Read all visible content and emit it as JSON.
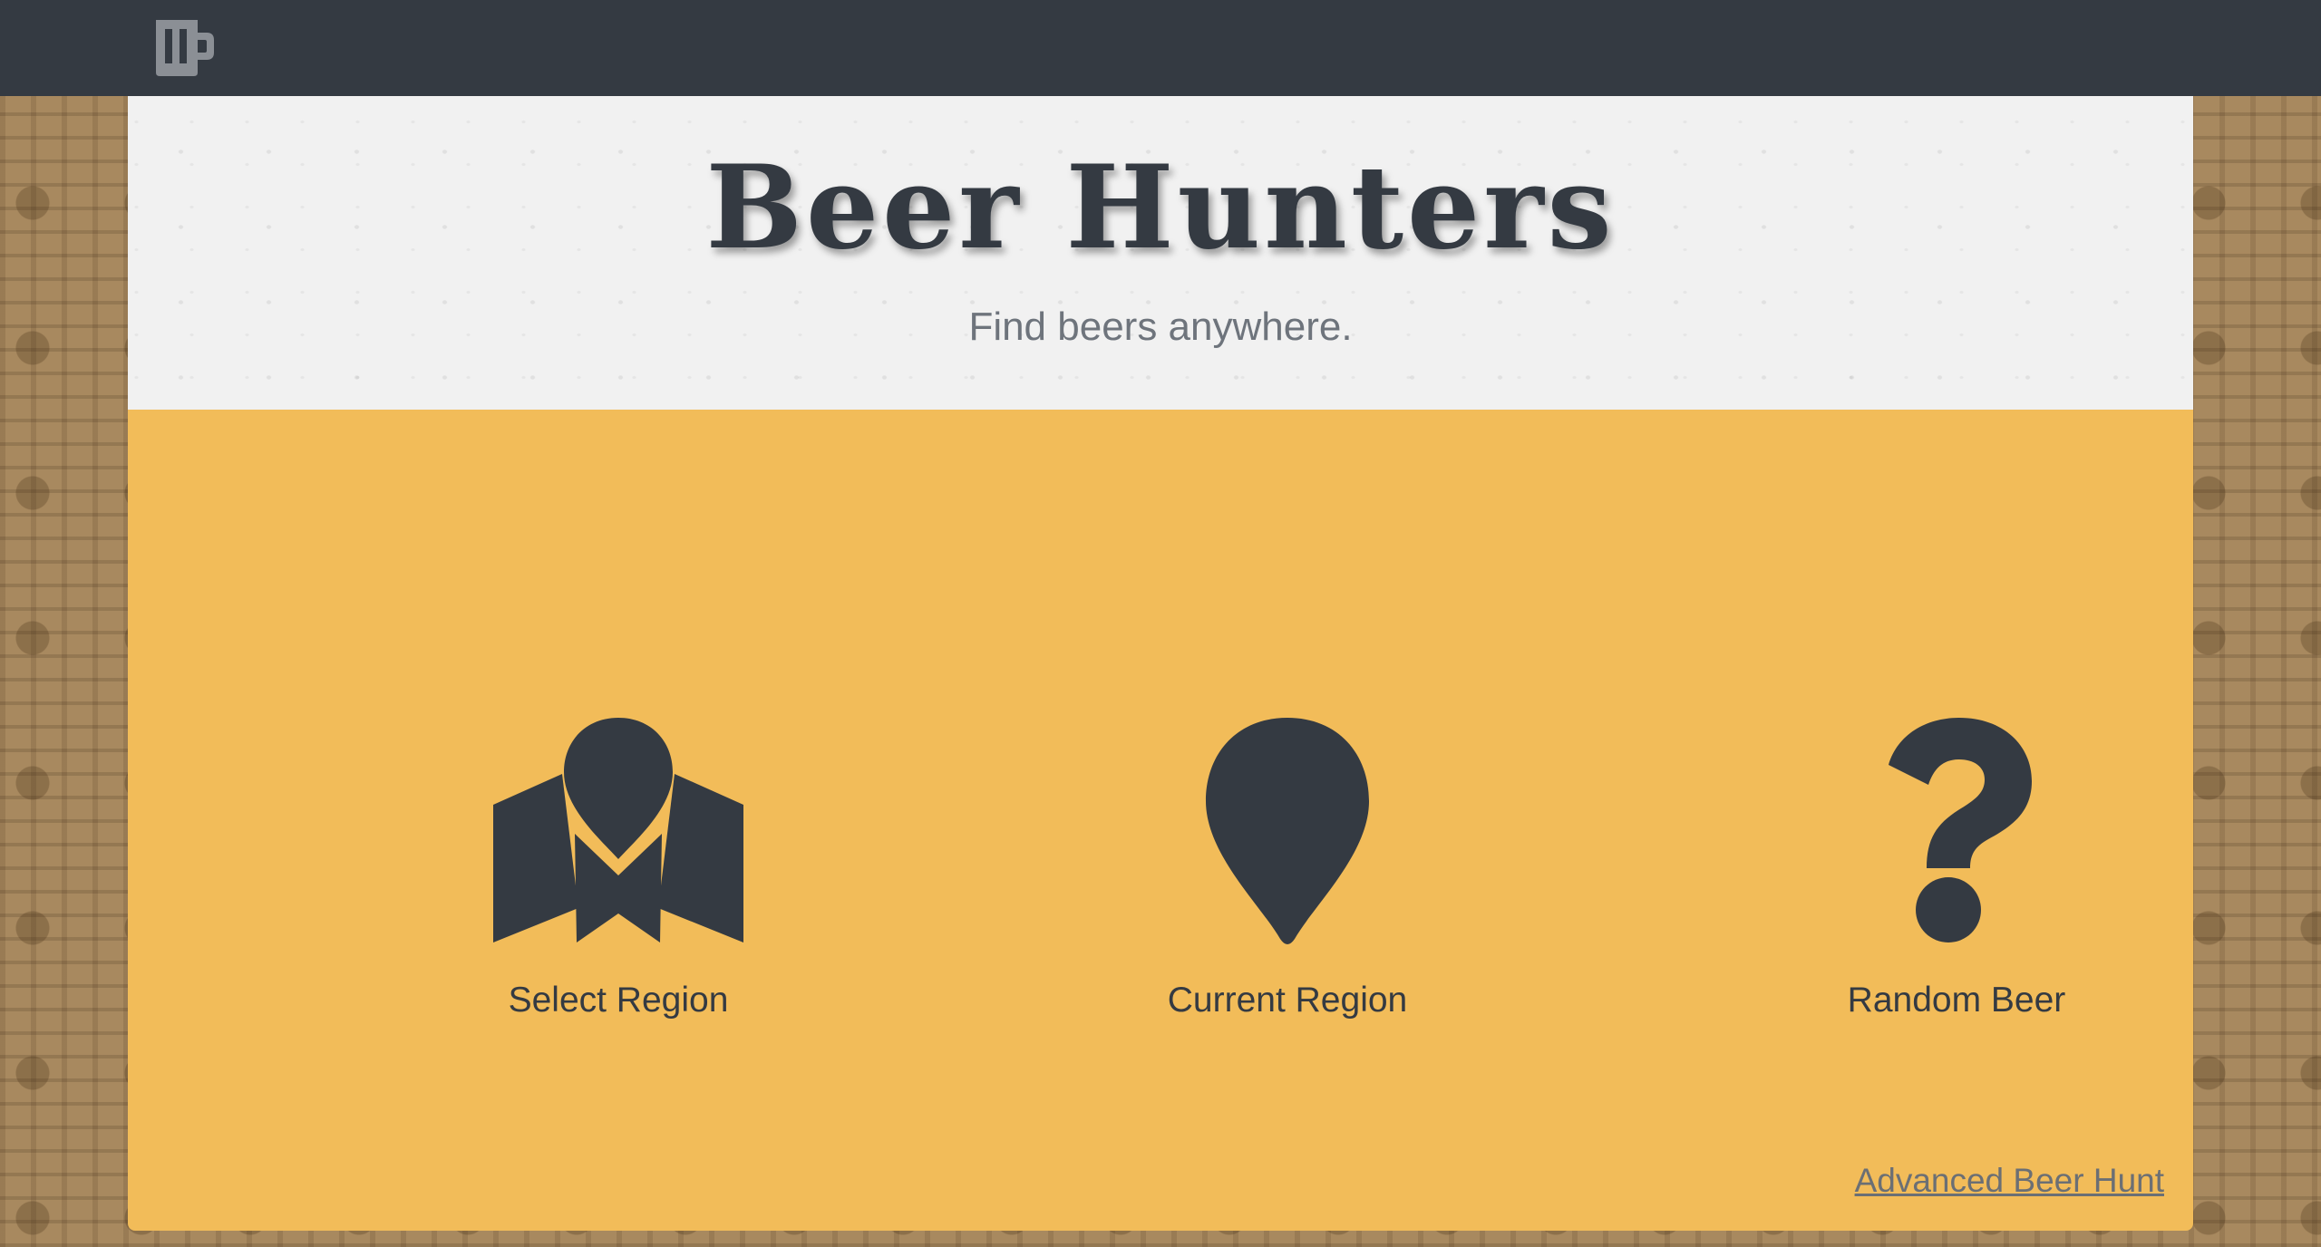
{
  "navbar": {
    "logo_icon": "beer-mug-icon",
    "background": "#343a42"
  },
  "hero": {
    "title": "Beer Hunters",
    "subtitle": "Find beers anywhere."
  },
  "options": [
    {
      "label": "Select Region",
      "icon": "map-marker-icon"
    },
    {
      "label": "Current Region",
      "icon": "location-pin-icon"
    },
    {
      "label": "Random Beer",
      "icon": "question-mark-icon"
    }
  ],
  "advanced_link": "Advanced Beer Hunt",
  "colors": {
    "panel": "#f2bc59",
    "dark": "#343a42",
    "hero_bg": "#f1f1f1"
  }
}
